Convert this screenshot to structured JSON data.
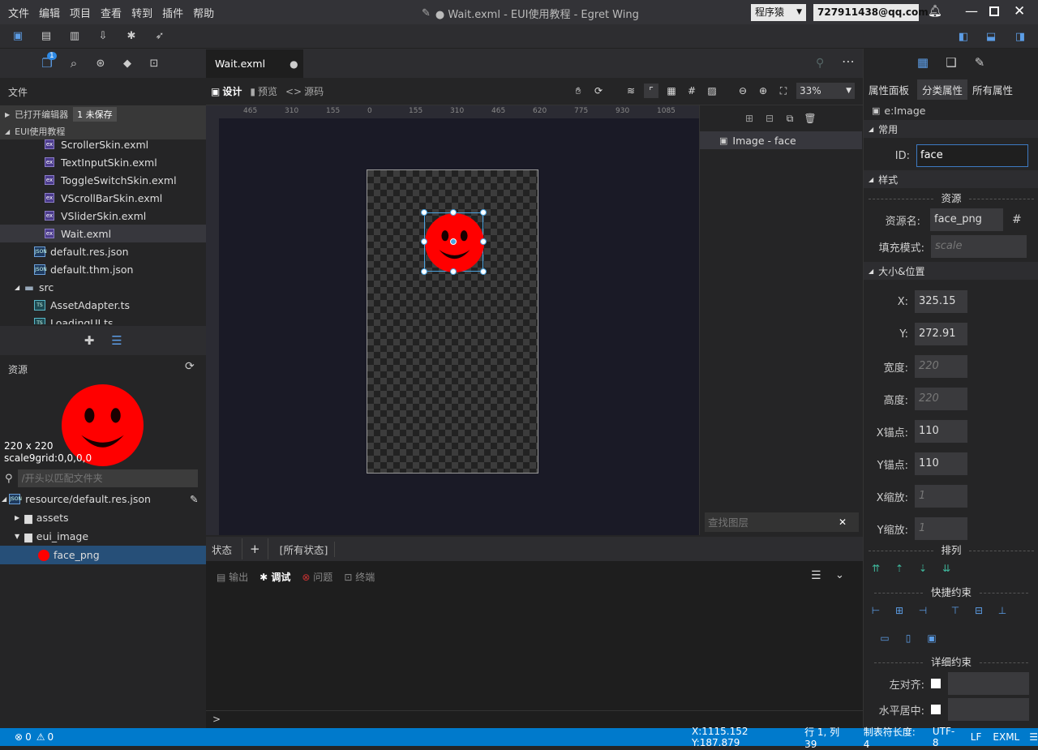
{
  "titlebar": {
    "menu": [
      "文件",
      "编辑",
      "项目",
      "查看",
      "转到",
      "插件",
      "帮助"
    ],
    "title": "● Wait.exml - EUI使用教程 - Egret Wing",
    "user": "程序猿",
    "email": "727911438@qq.com"
  },
  "leftpanel": {
    "badge": "1",
    "files_header": "文件",
    "opened_editors": "已打开编辑器",
    "unsaved": "1 未保存",
    "project": "EUI使用教程",
    "files": [
      {
        "name": "ScrollerSkin.exml",
        "icon": "exml"
      },
      {
        "name": "TextInputSkin.exml",
        "icon": "exml"
      },
      {
        "name": "ToggleSwitchSkin.exml",
        "icon": "exml"
      },
      {
        "name": "VScrollBarSkin.exml",
        "icon": "exml"
      },
      {
        "name": "VSliderSkin.exml",
        "icon": "exml"
      },
      {
        "name": "Wait.exml",
        "icon": "exml"
      },
      {
        "name": "default.res.json",
        "icon": "json"
      },
      {
        "name": "default.thm.json",
        "icon": "json"
      },
      {
        "name": "src",
        "icon": "folder"
      },
      {
        "name": "AssetAdapter.ts",
        "icon": "ts"
      },
      {
        "name": "LoadingUI.ts",
        "icon": "ts"
      }
    ],
    "resources_header": "资源",
    "preview_size": "220 x 220",
    "preview_grid": "scale9grid:0,0,0,0",
    "search_placeholder": "/开头以匹配文件夹",
    "res_root": "resource/default.res.json",
    "res_items": [
      "assets",
      "eui_image",
      "face_png"
    ]
  },
  "editor": {
    "tab": "Wait.exml",
    "modes": [
      "设计",
      "预览",
      "源码"
    ],
    "zoom": "33%",
    "ruler_top": [
      "465",
      "310",
      "155",
      "0",
      "155",
      "310",
      "465",
      "620",
      "775",
      "930",
      "1085"
    ],
    "layer_item": "Image - face",
    "layer_search": "查找图层"
  },
  "states": {
    "label": "状态",
    "all": "[所有状态]"
  },
  "output": {
    "tabs": [
      "输出",
      "调试",
      "问题",
      "终端"
    ],
    "prompt": ">"
  },
  "props": {
    "tabs": [
      "属性面板",
      "分类属性",
      "所有属性"
    ],
    "type": "e:Image",
    "sec_common": "常用",
    "id_label": "ID:",
    "id_value": "face",
    "sec_style": "样式",
    "res_title": "资源",
    "res_label": "资源名:",
    "res_value": "face_png",
    "fill_label": "填充模式:",
    "fill_placeholder": "scale",
    "sec_size": "大小&位置",
    "fields": [
      {
        "label": "X:",
        "value": "325.15",
        "ph": false
      },
      {
        "label": "Y:",
        "value": "272.91",
        "ph": false
      },
      {
        "label": "宽度:",
        "value": "220",
        "ph": true
      },
      {
        "label": "高度:",
        "value": "220",
        "ph": true
      },
      {
        "label": "X锚点:",
        "value": "110",
        "ph": false
      },
      {
        "label": "Y锚点:",
        "value": "110",
        "ph": false
      },
      {
        "label": "X缩放:",
        "value": "1",
        "ph": true
      },
      {
        "label": "Y缩放:",
        "value": "1",
        "ph": true
      }
    ],
    "arrange": "排列",
    "quick": "快捷约束",
    "detail": "详细约束",
    "left_align": "左对齐:",
    "hcenter": "水平居中:"
  },
  "statusbar": {
    "errors": "0",
    "warnings": "0",
    "coords": "X:1115.152 Y:187.879",
    "pos": "行 1, 列 39",
    "tab": "制表符长度: 4",
    "enc": "UTF-8",
    "eol": "LF",
    "lang": "EXML"
  },
  "colors": {
    "accent": "#007acc",
    "face": "#ff0000",
    "selected": "#264f78"
  }
}
